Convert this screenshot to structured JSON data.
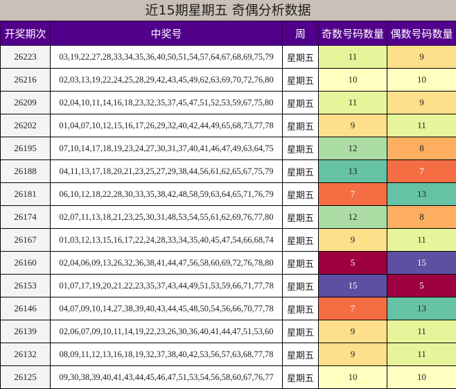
{
  "title": "近15期星期五 奇偶分析数据",
  "headers": [
    "开奖期次",
    "中奖号",
    "周",
    "奇数号码数量",
    "偶数号码数量"
  ],
  "rows": [
    {
      "issue": "26223",
      "numbers": "03,19,22,27,28,33,34,35,36,40,50,51,54,57,64,67,68,69,75,79",
      "week": "星期五",
      "odd": "11",
      "even": "9",
      "odd_color": "#e6f49a",
      "even_color": "#fee08b"
    },
    {
      "issue": "26216",
      "numbers": "02,03,13,19,22,24,25,28,29,42,43,45,49,62,63,69,70,72,76,80",
      "week": "星期五",
      "odd": "10",
      "even": "10",
      "odd_color": "#ffffbf",
      "even_color": "#ffffbf"
    },
    {
      "issue": "26209",
      "numbers": "02,04,10,11,14,16,18,23,32,35,37,45,47,51,52,53,59,67,75,80",
      "week": "星期五",
      "odd": "11",
      "even": "9",
      "odd_color": "#e6f49a",
      "even_color": "#fee08b"
    },
    {
      "issue": "26202",
      "numbers": "01,04,07,10,12,15,16,17,26,29,32,40,42,44,49,65,68,73,77,78",
      "week": "星期五",
      "odd": "9",
      "even": "11",
      "odd_color": "#fee08b",
      "even_color": "#e6f49a"
    },
    {
      "issue": "26195",
      "numbers": "07,10,14,17,18,19,23,24,27,30,31,37,40,41,46,47,49,63,64,75",
      "week": "星期五",
      "odd": "12",
      "even": "8",
      "odd_color": "#abdda4",
      "even_color": "#fdae61"
    },
    {
      "issue": "26188",
      "numbers": "04,11,13,17,18,20,21,23,25,27,29,38,44,56,61,62,65,67,75,79",
      "week": "星期五",
      "odd": "13",
      "even": "7",
      "odd_color": "#66c2a5",
      "even_color": "#f46d43"
    },
    {
      "issue": "26181",
      "numbers": "06,10,12,18,22,28,30,33,35,38,42,48,58,59,63,64,65,71,76,79",
      "week": "星期五",
      "odd": "7",
      "even": "13",
      "odd_color": "#f46d43",
      "even_color": "#66c2a5"
    },
    {
      "issue": "26174",
      "numbers": "02,07,11,13,18,21,23,25,30,31,48,53,54,55,61,62,69,76,77,80",
      "week": "星期五",
      "odd": "12",
      "even": "8",
      "odd_color": "#abdda4",
      "even_color": "#fdae61"
    },
    {
      "issue": "26167",
      "numbers": "01,03,12,13,15,16,17,22,24,28,33,34,35,40,45,47,54,66,68,74",
      "week": "星期五",
      "odd": "9",
      "even": "11",
      "odd_color": "#fee08b",
      "even_color": "#e6f49a"
    },
    {
      "issue": "26160",
      "numbers": "02,04,06,09,13,26,32,36,38,41,44,47,56,58,60,69,72,76,78,80",
      "week": "星期五",
      "odd": "5",
      "even": "15",
      "odd_color": "#9e0142",
      "even_color": "#5e4fa2"
    },
    {
      "issue": "26153",
      "numbers": "01,07,17,19,20,21,22,23,35,37,43,44,49,51,53,59,66,71,77,78",
      "week": "星期五",
      "odd": "15",
      "even": "5",
      "odd_color": "#5e4fa2",
      "even_color": "#9e0142"
    },
    {
      "issue": "26146",
      "numbers": "04,07,09,10,14,27,38,39,40,43,44,45,48,50,54,56,66,70,77,78",
      "week": "星期五",
      "odd": "7",
      "even": "13",
      "odd_color": "#f46d43",
      "even_color": "#66c2a5"
    },
    {
      "issue": "26139",
      "numbers": "02,06,07,09,10,11,14,19,22,23,26,30,36,40,41,44,47,51,53,60",
      "week": "星期五",
      "odd": "9",
      "even": "11",
      "odd_color": "#fee08b",
      "even_color": "#e6f49a"
    },
    {
      "issue": "26132",
      "numbers": "08,09,11,12,13,16,18,19,32,37,38,40,42,53,56,57,63,68,77,78",
      "week": "星期五",
      "odd": "9",
      "even": "11",
      "odd_color": "#fee08b",
      "even_color": "#e6f49a"
    },
    {
      "issue": "26125",
      "numbers": "09,30,38,39,40,41,43,44,45,46,47,51,53,54,56,58,60,67,76,77",
      "week": "星期五",
      "odd": "10",
      "even": "10",
      "odd_color": "#ffffbf",
      "even_color": "#ffffbf"
    }
  ]
}
